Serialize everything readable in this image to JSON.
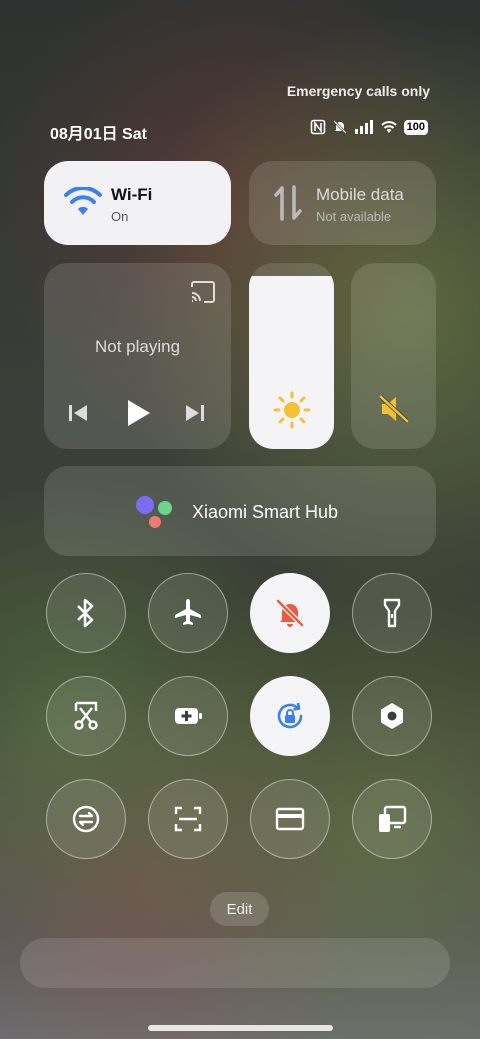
{
  "status": {
    "network_text": "Emergency calls only",
    "date_text": "08月01日 Sat",
    "battery_level": "100",
    "icons": [
      "nfc-icon",
      "mute-icon",
      "signal-icon",
      "wifi-icon",
      "battery-icon"
    ]
  },
  "wifi": {
    "title": "Wi-Fi",
    "subtitle": "On",
    "accent": "#3b7ff5"
  },
  "mobile_data": {
    "title": "Mobile data",
    "subtitle": "Not available"
  },
  "media": {
    "status": "Not playing"
  },
  "brightness": {
    "level": 0.93,
    "icon_color": "#f3c132"
  },
  "volume": {
    "muted": true,
    "icon_color": "#f3c132"
  },
  "smart_hub": {
    "label": "Xiaomi Smart Hub"
  },
  "toggles": [
    {
      "name": "bluetooth",
      "icon": "bluetooth-icon",
      "active": false
    },
    {
      "name": "airplane",
      "icon": "airplane-icon",
      "active": false
    },
    {
      "name": "silent",
      "icon": "bell-off-icon",
      "active": true,
      "color": "#f05a3c"
    },
    {
      "name": "flashlight",
      "icon": "flashlight-icon",
      "active": false
    },
    {
      "name": "screenshot",
      "icon": "scissors-icon",
      "active": false
    },
    {
      "name": "battery-saver",
      "icon": "battery-plus-icon",
      "active": false
    },
    {
      "name": "rotation-lock",
      "icon": "rotation-lock-icon",
      "active": true,
      "color": "#3b7ff5"
    },
    {
      "name": "settings",
      "icon": "hex-gear-icon",
      "active": false
    },
    {
      "name": "sync",
      "icon": "sync-icon",
      "active": false
    },
    {
      "name": "scanner",
      "icon": "scan-icon",
      "active": false
    },
    {
      "name": "card",
      "icon": "card-icon",
      "active": false
    },
    {
      "name": "cast-devices",
      "icon": "devices-icon",
      "active": false
    }
  ],
  "edit": {
    "label": "Edit"
  }
}
